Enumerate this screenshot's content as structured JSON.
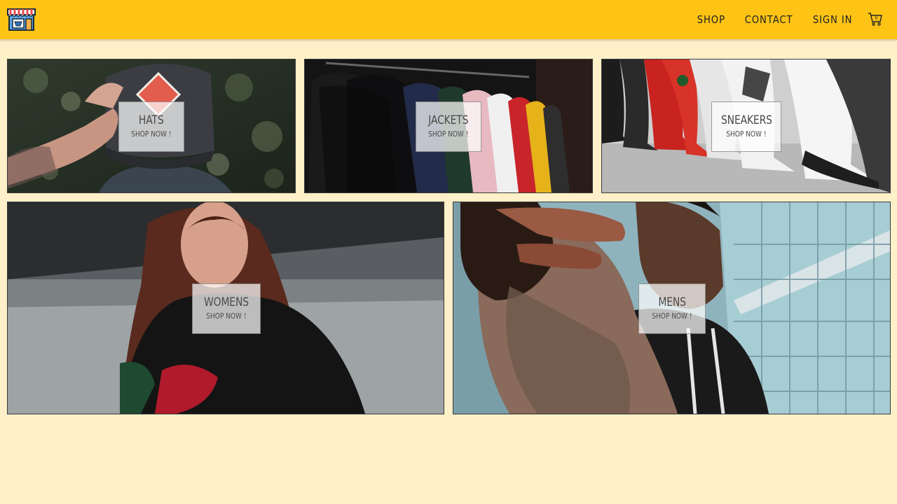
{
  "header": {
    "logo_icon": "storefront-icon",
    "nav": [
      {
        "label": "SHOP"
      },
      {
        "label": "CONTACT"
      },
      {
        "label": "SIGN IN"
      }
    ],
    "cart_icon": "cart-icon",
    "cart_count": "0",
    "background_color": "#fdc315"
  },
  "page": {
    "background_color": "#fef0c8"
  },
  "categories": [
    {
      "title": "HATS",
      "subtitle": "SHOP NOW !"
    },
    {
      "title": "JACKETS",
      "subtitle": "SHOP NOW !"
    },
    {
      "title": "SNEAKERS",
      "subtitle": "SHOP NOW !"
    },
    {
      "title": "WOMENS",
      "subtitle": "SHOP NOW !"
    },
    {
      "title": "MENS",
      "subtitle": "SHOP NOW !"
    }
  ]
}
